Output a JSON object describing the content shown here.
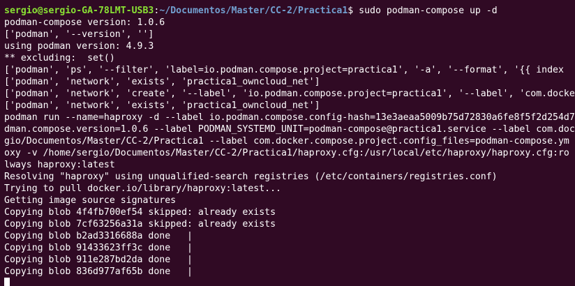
{
  "colors": {
    "background": "#300a24",
    "foreground": "#ffffff",
    "prompt_user": "#8ae234",
    "prompt_path": "#729fcf"
  },
  "prompt": {
    "user_host": "sergio@sergio-GA-78LMT-USB3",
    "separator": ":",
    "path": "~/Documentos/Master/CC-2/Practica1",
    "symbol": "$ ",
    "command": "sudo podman-compose up -d"
  },
  "output_lines": [
    "podman-compose version: 1.0.6",
    "['podman', '--version', '']",
    "using podman version: 4.9.3",
    "** excluding:  set()",
    "['podman', 'ps', '--filter', 'label=io.podman.compose.project=practica1', '-a', '--format', '{{ index",
    "['podman', 'network', 'exists', 'practica1_owncloud_net']",
    "['podman', 'network', 'create', '--label', 'io.podman.compose.project=practica1', '--label', 'com.docke",
    "['podman', 'network', 'exists', 'practica1_owncloud_net']",
    "podman run --name=haproxy -d --label io.podman.compose.config-hash=13e3aeaa5009b75d72830a6fe8f5f2d254d7",
    "dman.compose.version=1.0.6 --label PODMAN_SYSTEMD_UNIT=podman-compose@practica1.service --label com.doc",
    "gio/Documentos/Master/CC-2/Practica1 --label com.docker.compose.project.config_files=podman-compose.ym",
    "oxy -v /home/sergio/Documentos/Master/CC-2/Practica1/haproxy.cfg:/usr/local/etc/haproxy/haproxy.cfg:ro",
    "lways haproxy:latest",
    "Resolving \"haproxy\" using unqualified-search registries (/etc/containers/registries.conf)",
    "Trying to pull docker.io/library/haproxy:latest...",
    "Getting image source signatures",
    "Copying blob 4f4fb700ef54 skipped: already exists",
    "Copying blob 7cf63256a31a skipped: already exists",
    "Copying blob b2ad3316688a done   |",
    "Copying blob 91433623ff3c done   |",
    "Copying blob 911e287bd2da done   |",
    "Copying blob 836d977af65b done   |"
  ]
}
